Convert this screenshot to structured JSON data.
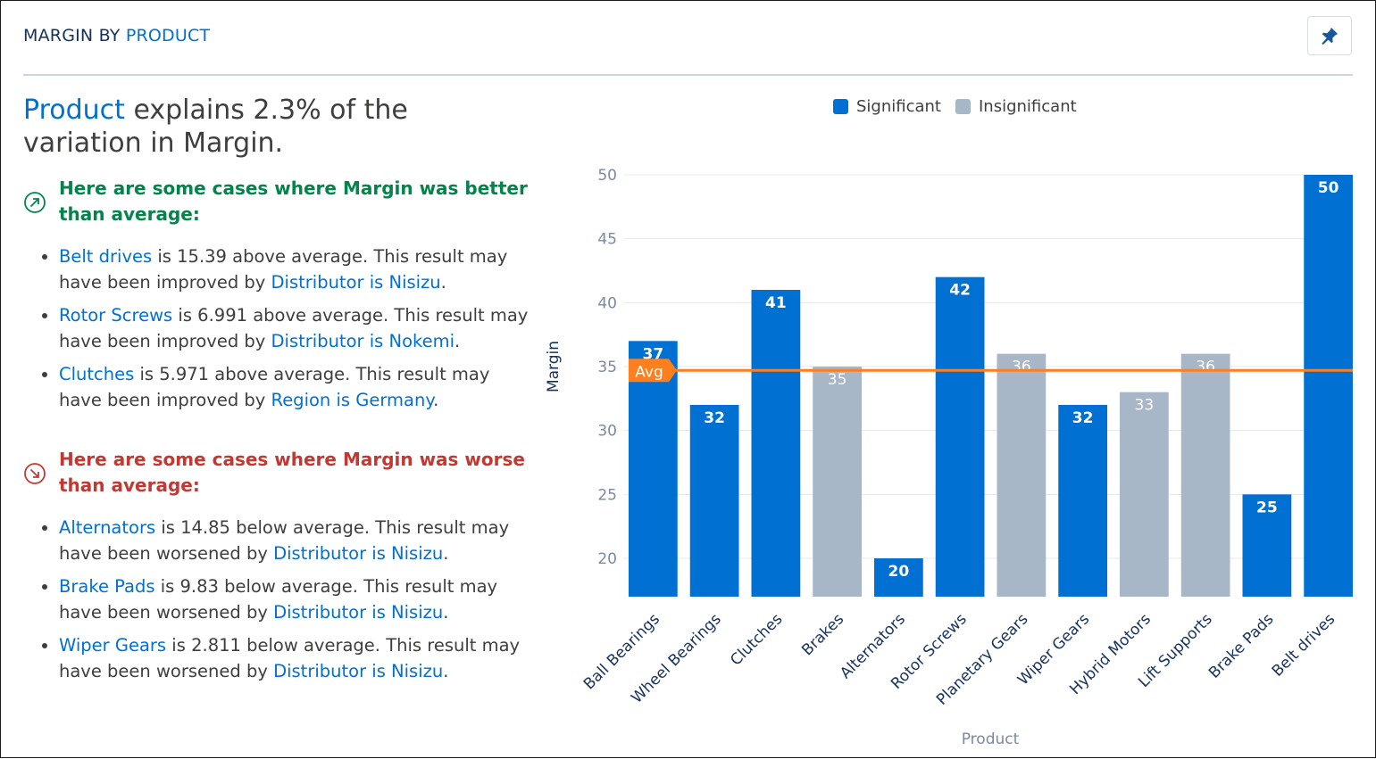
{
  "header": {
    "title_prefix": "MARGIN BY",
    "title_accent": "PRODUCT",
    "pin_icon": "pin-icon"
  },
  "headline": {
    "accent": "Product",
    "rest": " explains 2.3% of the variation in Margin."
  },
  "better": {
    "title": "Here are some cases where Margin was better than average:",
    "icon": "arrow-up-right-circle-icon",
    "color": "#04844b",
    "items": [
      {
        "link": "Belt drives",
        "text": " is 15.39 above average. This result may have been improved by ",
        "link2": "Distributor is Nisizu",
        "end": "."
      },
      {
        "link": "Rotor Screws",
        "text": " is 6.991 above average. This result may have been improved by ",
        "link2": "Distributor is Nokemi",
        "end": "."
      },
      {
        "link": "Clutches",
        "text": " is 5.971 above average. This result may have been improved by ",
        "link2": "Region is Germany",
        "end": "."
      }
    ]
  },
  "worse": {
    "title": "Here are some cases where Margin was worse than average:",
    "icon": "arrow-down-right-circle-icon",
    "color": "#c23934",
    "items": [
      {
        "link": "Alternators",
        "text": " is 14.85 below average. This result may have been worsened by ",
        "link2": "Distributor is Nisizu",
        "end": "."
      },
      {
        "link": "Brake Pads",
        "text": " is 9.83 below average. This result may have been worsened by ",
        "link2": "Distributor is Nisizu",
        "end": "."
      },
      {
        "link": "Wiper Gears",
        "text": " is 2.811 below average. This result may have been worsened by ",
        "link2": "Distributor is Nisizu",
        "end": "."
      }
    ]
  },
  "chart_data": {
    "type": "bar",
    "title": "",
    "xlabel": "Product",
    "ylabel": "Margin",
    "ylim": [
      17,
      50
    ],
    "yticks": [
      20,
      25,
      30,
      35,
      40,
      45,
      50
    ],
    "grid": true,
    "legend": {
      "placement": "top",
      "entries": [
        {
          "name": "Significant",
          "color": "#0070d2"
        },
        {
          "name": "Insignificant",
          "color": "#a8b7c7"
        }
      ]
    },
    "average": {
      "label": "Avg",
      "value": 34.7,
      "color": "#ff7f1e"
    },
    "categories": [
      "Ball Bearings",
      "Wheel Bearings",
      "Clutches",
      "Brakes",
      "Alternators",
      "Rotor Screws",
      "Planetary Gears",
      "Wiper Gears",
      "Hybrid Motors",
      "Lift Supports",
      "Brake Pads",
      "Belt drives"
    ],
    "values": [
      37,
      32,
      41,
      35,
      20,
      42,
      36,
      32,
      33,
      36,
      25,
      50
    ],
    "significant": [
      true,
      true,
      true,
      false,
      true,
      true,
      false,
      true,
      false,
      false,
      true,
      true
    ]
  }
}
